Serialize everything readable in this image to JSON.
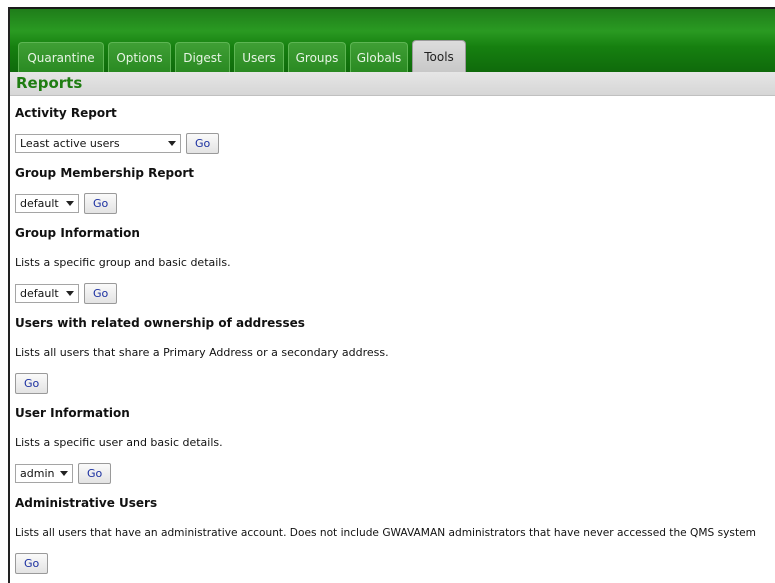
{
  "tabs": [
    {
      "label": "Quarantine",
      "width": 86
    },
    {
      "label": "Options",
      "width": 63
    },
    {
      "label": "Digest",
      "width": 55
    },
    {
      "label": "Users",
      "width": 50
    },
    {
      "label": "Groups",
      "width": 58
    },
    {
      "label": "Globals",
      "width": 58
    },
    {
      "label": "Tools",
      "width": 54,
      "active": true
    }
  ],
  "section": {
    "title": "Reports"
  },
  "reports": {
    "activity": {
      "heading": "Activity Report",
      "select_value": "Least active users",
      "go_label": "Go"
    },
    "group_membership": {
      "heading": "Group Membership Report",
      "select_value": "default",
      "go_label": "Go"
    },
    "group_information": {
      "heading": "Group Information",
      "description": "Lists a specific group and basic details.",
      "select_value": "default",
      "go_label": "Go"
    },
    "related_ownership": {
      "heading": "Users with related ownership of addresses",
      "description": "Lists all users that share a Primary Address or a secondary address.",
      "go_label": "Go"
    },
    "user_information": {
      "heading": "User Information",
      "description": "Lists a specific user and basic details.",
      "select_value": "admin",
      "go_label": "Go"
    },
    "administrative_users": {
      "heading": "Administrative Users",
      "description": "Lists all users that have an administrative account. Does not include GWAVAMAN administrators that have never accessed the QMS system",
      "go_label": "Go"
    }
  }
}
